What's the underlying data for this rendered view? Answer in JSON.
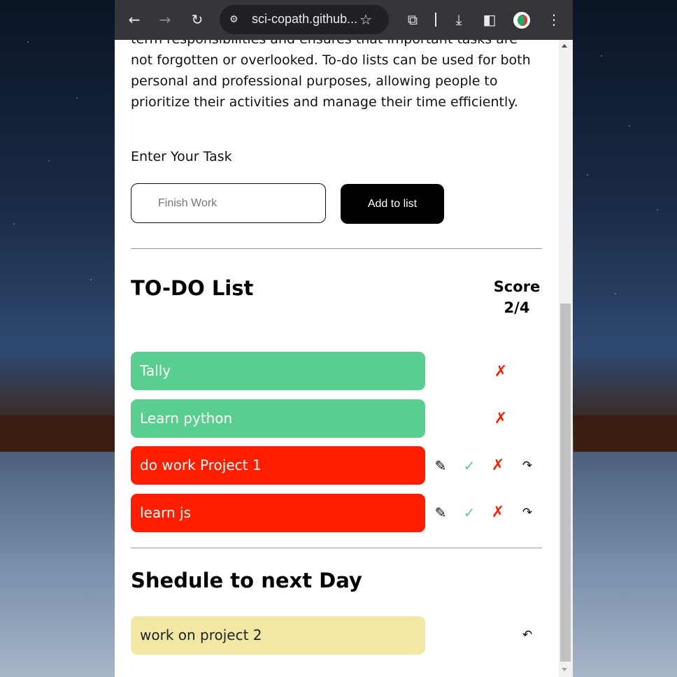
{
  "browser": {
    "url": "sci-copath.github...",
    "icons": [
      "back-icon",
      "forward-icon",
      "reload-icon",
      "tune-icon",
      "star-icon",
      "extensions-icon",
      "download-icon",
      "side-panel-icon",
      "profile-avatar",
      "menu-icon"
    ]
  },
  "intro": {
    "text": "term responsibilities and ensures that important tasks are not forgotten or overlooked. To-do lists can be used for both personal and professional purposes, allowing people to prioritize their activities and manage their time efficiently."
  },
  "form": {
    "label": "Enter Your Task",
    "placeholder": "Finish Work",
    "add_button": "Add to list"
  },
  "todo": {
    "title": "TO-DO List",
    "score_label": "Score",
    "score_value": "2/4",
    "tasks": [
      {
        "text": "Tally",
        "status": "done"
      },
      {
        "text": "Learn python",
        "status": "done"
      },
      {
        "text": "do work Project 1",
        "status": "pending"
      },
      {
        "text": "learn js",
        "status": "pending"
      }
    ]
  },
  "icons": {
    "edit": "✎",
    "check": "✓",
    "delete": "✗",
    "move_next_day": "↷",
    "restore": "↶"
  },
  "schedule": {
    "title": "Shedule to next Day",
    "tasks": [
      {
        "text": "work on project 2"
      }
    ]
  },
  "colors": {
    "done": "#5ace8f",
    "pending": "#ff1e00",
    "scheduled": "#f2e8a4"
  }
}
